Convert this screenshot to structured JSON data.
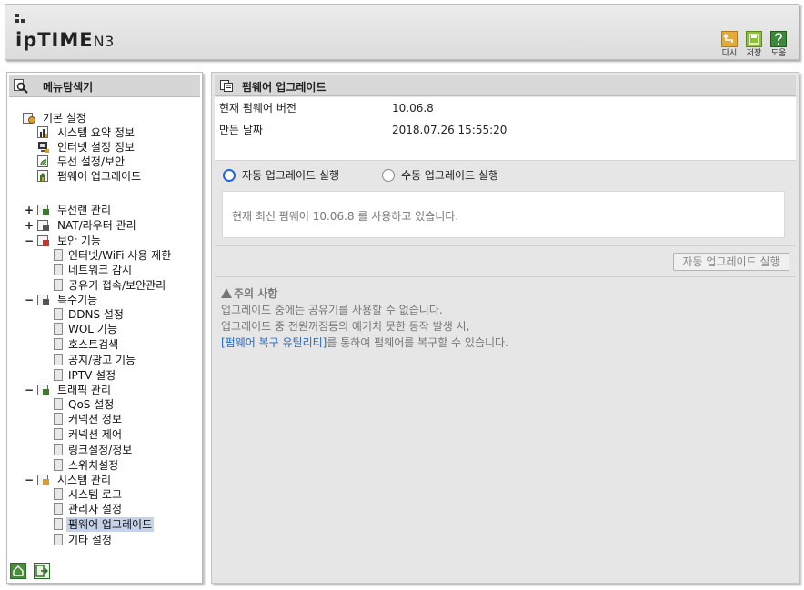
{
  "header": {
    "logo_text": "ipTIME",
    "model": "N3",
    "buttons": [
      {
        "label": "다시",
        "icon": "undo-icon",
        "color": "#e2a93b"
      },
      {
        "label": "저장",
        "icon": "save-icon",
        "color": "#8fbf3b"
      },
      {
        "label": "도움",
        "icon": "help-icon",
        "color": "#3b8a3b"
      }
    ]
  },
  "sidebar": {
    "title": "메뉴탐색기",
    "basic": {
      "label": "기본 설정",
      "items": [
        "시스템 요약 정보",
        "인터넷 설정 정보",
        "무선 설정/보안",
        "펌웨어 업그레이드"
      ]
    },
    "groups": [
      {
        "toggle": "+",
        "label": "무선랜 관리",
        "items": []
      },
      {
        "toggle": "+",
        "label": "NAT/라우터 관리",
        "items": []
      },
      {
        "toggle": "−",
        "label": "보안 기능",
        "items": [
          "인터넷/WiFi 사용 제한",
          "네트워크 감시",
          "공유기 접속/보안관리"
        ]
      },
      {
        "toggle": "−",
        "label": "특수기능",
        "items": [
          "DDNS 설정",
          "WOL 기능",
          "호스트검색",
          "공지/광고 기능",
          "IPTV 설정"
        ]
      },
      {
        "toggle": "−",
        "label": "트래픽 관리",
        "items": [
          "QoS 설정",
          "커넥션 정보",
          "커넥션 제어",
          "링크설정/정보",
          "스위치설정"
        ]
      },
      {
        "toggle": "−",
        "label": "시스템 관리",
        "items": [
          "시스템 로그",
          "관리자 설정",
          "펌웨어 업그레이드",
          "기타 설정"
        ]
      }
    ],
    "selected": "펌웨어 업그레이드",
    "bottom_icons": [
      "home-icon",
      "logout-icon"
    ]
  },
  "main": {
    "title": "펌웨어 업그레이드",
    "info": [
      {
        "key": "현재 펌웨어 버전",
        "value": "10.06.8"
      },
      {
        "key": "만든 날짜",
        "value": "2018.07.26 15:55:20"
      }
    ],
    "radio_auto": "자동 업그레이드 실행",
    "radio_manual": "수동 업그레이드 실행",
    "radio_selected": "auto",
    "status_message": "현재 최신 펌웨어 10.06.8 를 사용하고 있습니다.",
    "run_button": "자동 업그레이드 실행",
    "notice": {
      "title": "주의 사항",
      "line1": "업그레이드 중에는 공유기를 사용할 수 없습니다.",
      "line2": "업그레이드 중 전원꺼짐등의 예기치 못한 동작 발생 시,",
      "line3_link": "[펌웨어 복구 유틸리티]",
      "line3_rest": "를 통하여 펌웨어를 복구할 수 있습니다."
    }
  },
  "colors": {
    "accent": "#2266dd",
    "link": "#2a68b8",
    "selected_bg": "#c5d3ea"
  }
}
